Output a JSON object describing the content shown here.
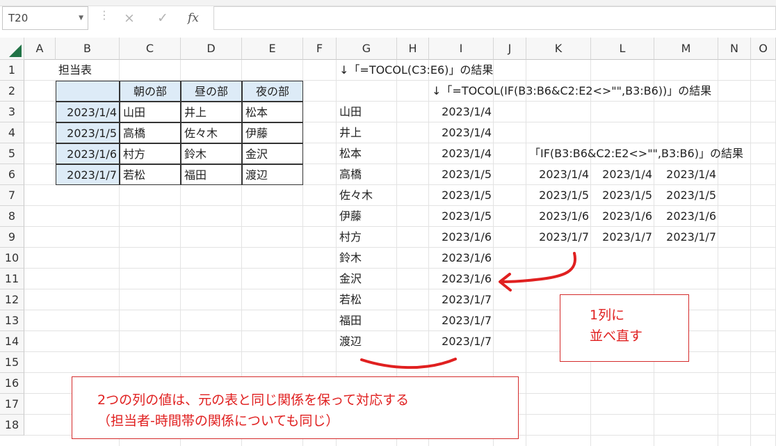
{
  "formula_bar": {
    "name_box": "T20",
    "cancel_icon": "×",
    "enter_icon": "✓",
    "fx_label": "fx",
    "formula": ""
  },
  "columns": [
    "A",
    "B",
    "C",
    "D",
    "E",
    "F",
    "G",
    "H",
    "I",
    "J",
    "K",
    "L",
    "M",
    "N",
    "O"
  ],
  "rows": [
    "1",
    "2",
    "3",
    "4",
    "5",
    "6",
    "7",
    "8",
    "9",
    "10",
    "11",
    "12",
    "13",
    "14",
    "15",
    "16",
    "17",
    "18"
  ],
  "cells": {
    "B1": "担当表",
    "C2": "朝の部",
    "D2": "昼の部",
    "E2": "夜の部",
    "B3": "2023/1/4",
    "C3": "山田",
    "D3": "井上",
    "E3": "松本",
    "B4": "2023/1/5",
    "C4": "高橋",
    "D4": "佐々木",
    "E4": "伊藤",
    "B5": "2023/1/6",
    "C5": "村方",
    "D5": "鈴木",
    "E5": "金沢",
    "B6": "2023/1/7",
    "C6": "若松",
    "D6": "福田",
    "E6": "渡辺",
    "G1": "↓「=TOCOL(C3:E6)」の結果",
    "I2": "↓「=TOCOL(IF(B3:B6&C2:E2<>\"\",B3:B6))」の結果",
    "K5": "「IF(B3:B6&C2:E2<>\"\",B3:B6)」の結果",
    "G_list": [
      "山田",
      "井上",
      "松本",
      "高橋",
      "佐々木",
      "伊藤",
      "村方",
      "鈴木",
      "金沢",
      "若松",
      "福田",
      "渡辺"
    ],
    "I_list": [
      "2023/1/4",
      "2023/1/4",
      "2023/1/4",
      "2023/1/5",
      "2023/1/5",
      "2023/1/5",
      "2023/1/6",
      "2023/1/6",
      "2023/1/6",
      "2023/1/7",
      "2023/1/7",
      "2023/1/7"
    ],
    "K6": "2023/1/4",
    "L6": "2023/1/4",
    "M6": "2023/1/4",
    "K7": "2023/1/5",
    "L7": "2023/1/5",
    "M7": "2023/1/5",
    "K8": "2023/1/6",
    "L8": "2023/1/6",
    "M8": "2023/1/6",
    "K9": "2023/1/7",
    "L9": "2023/1/7",
    "M9": "2023/1/7"
  },
  "annotations": {
    "box1_line1": "1列に",
    "box1_line2": "並べ直す",
    "box2_line1": "2つの列の値は、元の表と同じ関係を保って対応する",
    "box2_line2": "（担当者-時間帯の関係についても同じ）",
    "color": "#e02020"
  },
  "colors": {
    "header_fill": "#ddebf7",
    "excel_green": "#217346"
  }
}
